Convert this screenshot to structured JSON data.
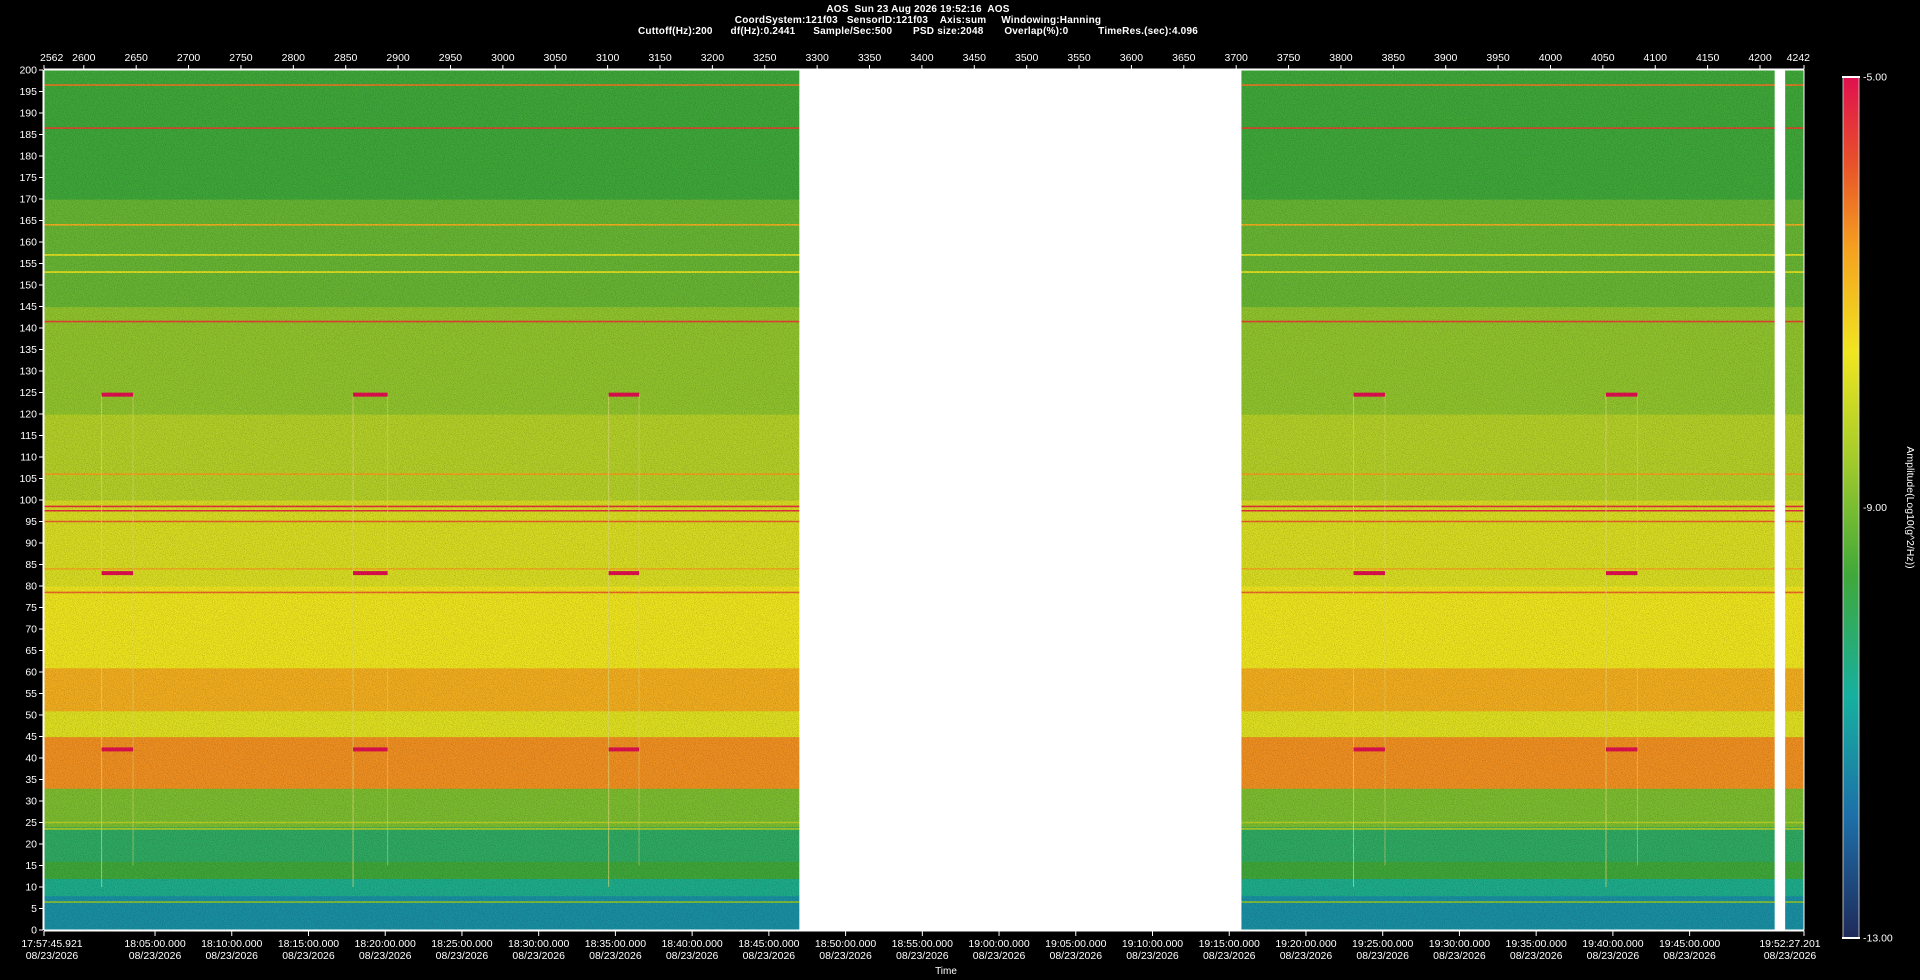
{
  "header": {
    "line1": "AOS  Sun 23 Aug 2026 19:52:16  AOS",
    "line2": "CoordSystem:121f03   SensorID:121f03    Axis:sum     Windowing:Hanning",
    "line3": "Cuttoff(Hz):200      df(Hz):0.2441      Sample/Sec:500       PSD size:2048       Overlap(%):0          TimeRes.(sec):4.096"
  },
  "colors": {
    "background": "#000000",
    "gap": "#ffffff",
    "colormap": [
      "#1f2a5a",
      "#1d6fa8",
      "#16b0a0",
      "#3fa83a",
      "#a6cc2a",
      "#f0e61f",
      "#f5a11f",
      "#e8512a",
      "#e0104f"
    ]
  },
  "chart_data": {
    "type": "heatmap",
    "title": "",
    "xlabel": "Time",
    "ylabel": "",
    "colorbar_label": "Amplitude(Log10(g^2/Hz))",
    "colorbar_ticks": [
      "-5.00",
      "-9.00",
      "-13.00"
    ],
    "colorbar_range": [
      -13,
      -5
    ],
    "ylim": [
      0,
      200
    ],
    "y_ticks": [
      200,
      195,
      190,
      185,
      180,
      175,
      170,
      165,
      160,
      155,
      150,
      145,
      140,
      135,
      130,
      125,
      120,
      115,
      110,
      105,
      100,
      95,
      90,
      85,
      80,
      75,
      70,
      65,
      60,
      55,
      50,
      45,
      40,
      35,
      30,
      25,
      20,
      15,
      10,
      5,
      0
    ],
    "top_axis_range": [
      2562,
      4242
    ],
    "top_ticks": [
      "2562",
      "2600",
      "2650",
      "2700",
      "2750",
      "2800",
      "2850",
      "2900",
      "2950",
      "3000",
      "3050",
      "3100",
      "3150",
      "3200",
      "3250",
      "3300",
      "3350",
      "3400",
      "3450",
      "3500",
      "3550",
      "3600",
      "3650",
      "3700",
      "3750",
      "3800",
      "3850",
      "3900",
      "3950",
      "4000",
      "4050",
      "4100",
      "4150",
      "4200",
      "4242"
    ],
    "time_ticks": [
      {
        "time": "17:57:45.921",
        "date": "08/23/2026"
      },
      {
        "time": "18:05:00.000",
        "date": "08/23/2026"
      },
      {
        "time": "18:10:00.000",
        "date": "08/23/2026"
      },
      {
        "time": "18:15:00.000",
        "date": "08/23/2026"
      },
      {
        "time": "18:20:00.000",
        "date": "08/23/2026"
      },
      {
        "time": "18:25:00.000",
        "date": "08/23/2026"
      },
      {
        "time": "18:30:00.000",
        "date": "08/23/2026"
      },
      {
        "time": "18:35:00.000",
        "date": "08/23/2026"
      },
      {
        "time": "18:40:00.000",
        "date": "08/23/2026"
      },
      {
        "time": "18:45:00.000",
        "date": "08/23/2026"
      },
      {
        "time": "18:50:00.000",
        "date": "08/23/2026"
      },
      {
        "time": "18:55:00.000",
        "date": "08/23/2026"
      },
      {
        "time": "19:00:00.000",
        "date": "08/23/2026"
      },
      {
        "time": "19:05:00.000",
        "date": "08/23/2026"
      },
      {
        "time": "19:10:00.000",
        "date": "08/23/2026"
      },
      {
        "time": "19:15:00.000",
        "date": "08/23/2026"
      },
      {
        "time": "19:20:00.000",
        "date": "08/23/2026"
      },
      {
        "time": "19:25:00.000",
        "date": "08/23/2026"
      },
      {
        "time": "19:30:00.000",
        "date": "08/23/2026"
      },
      {
        "time": "19:35:00.000",
        "date": "08/23/2026"
      },
      {
        "time": "19:40:00.000",
        "date": "08/23/2026"
      },
      {
        "time": "19:45:00.000",
        "date": "08/23/2026"
      },
      {
        "time": "19:52:27.201",
        "date": "08/23/2026"
      }
    ],
    "data_gaps": [
      [
        3283,
        3705
      ],
      [
        4214,
        4224
      ]
    ],
    "frequency_bands": [
      {
        "from": 0,
        "to": 8,
        "level": -11.5
      },
      {
        "from": 8,
        "to": 12,
        "level": -10.8
      },
      {
        "from": 12,
        "to": 16,
        "level": -10.0
      },
      {
        "from": 16,
        "to": 24,
        "level": -10.4
      },
      {
        "from": 24,
        "to": 33,
        "level": -9.4
      },
      {
        "from": 33,
        "to": 45,
        "level": -6.8
      },
      {
        "from": 45,
        "to": 51,
        "level": -8.2
      },
      {
        "from": 51,
        "to": 61,
        "level": -7.2
      },
      {
        "from": 61,
        "to": 80,
        "level": -8.0
      },
      {
        "from": 80,
        "to": 100,
        "level": -8.3
      },
      {
        "from": 100,
        "to": 120,
        "level": -8.8
      },
      {
        "from": 120,
        "to": 145,
        "level": -9.2
      },
      {
        "from": 145,
        "to": 170,
        "level": -9.6
      },
      {
        "from": 170,
        "to": 200,
        "level": -10.0
      }
    ],
    "spectral_lines": [
      {
        "freq": 196.5,
        "level": -6.5
      },
      {
        "freq": 186.5,
        "level": -5.8
      },
      {
        "freq": 164.0,
        "level": -7.2
      },
      {
        "freq": 157.0,
        "level": -8.0
      },
      {
        "freq": 153.0,
        "level": -8.0
      },
      {
        "freq": 141.5,
        "level": -5.8
      },
      {
        "freq": 106.0,
        "level": -7.0
      },
      {
        "freq": 98.5,
        "level": -5.5
      },
      {
        "freq": 97.5,
        "level": -5.5
      },
      {
        "freq": 95.0,
        "level": -6.2
      },
      {
        "freq": 84.0,
        "level": -7.2
      },
      {
        "freq": 78.5,
        "level": -6.3
      },
      {
        "freq": 25.0,
        "level": -8.8
      },
      {
        "freq": 23.5,
        "level": -8.8
      },
      {
        "freq": 6.5,
        "level": -9.2
      }
    ],
    "events": [
      {
        "from": 2617,
        "to": 2647
      },
      {
        "from": 2857,
        "to": 2890
      },
      {
        "from": 3101,
        "to": 3130
      },
      {
        "from": 3812,
        "to": 3842
      },
      {
        "from": 4053,
        "to": 4083
      }
    ],
    "event_lines": [
      {
        "freq": 124.5,
        "level": -5.0
      },
      {
        "freq": 83.0,
        "level": -5.0
      },
      {
        "freq": 42.0,
        "level": -5.0
      }
    ]
  }
}
